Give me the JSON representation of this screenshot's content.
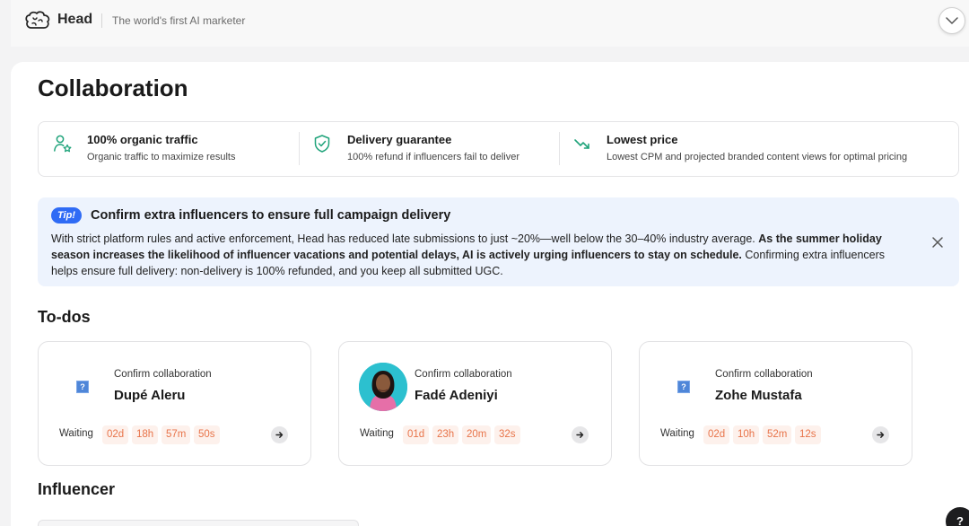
{
  "header": {
    "brand_name": "Head",
    "tagline": "The world's first AI marketer"
  },
  "page": {
    "title": "Collaboration"
  },
  "features": [
    {
      "icon": "user-star-icon",
      "title": "100% organic traffic",
      "desc": "Organic traffic to maximize results"
    },
    {
      "icon": "shield-check-icon",
      "title": "Delivery guarantee",
      "desc": "100% refund if influencers fail to deliver"
    },
    {
      "icon": "trend-down-icon",
      "title": "Lowest price",
      "desc": "Lowest CPM and projected branded content views for optimal pricing"
    }
  ],
  "tip": {
    "badge": "Tip!",
    "title": "Confirm extra influencers to ensure full campaign delivery",
    "body_1": "With strict platform rules and active enforcement, Head has reduced late submissions to just ~20%—well below the 30–40% industry average.",
    "body_bold": "As the summer holiday season increases the likelihood of influencer vacations and potential delays, AI is actively urging influencers to stay on schedule.",
    "body_2": "Confirming extra influencers helps ensure full delivery: non-delivery is 100% refunded, and you keep all submitted UGC."
  },
  "todos": {
    "title": "To-dos",
    "cards": [
      {
        "subtitle": "Confirm collaboration",
        "name": "Dupé Aleru",
        "wait_label": "Waiting",
        "days": "02d",
        "hours": "18h",
        "minutes": "57m",
        "seconds": "50s"
      },
      {
        "subtitle": "Confirm collaboration",
        "name": "Fadé Adeniyi",
        "wait_label": "Waiting",
        "days": "01d",
        "hours": "23h",
        "minutes": "20m",
        "seconds": "32s"
      },
      {
        "subtitle": "Confirm collaboration",
        "name": "Zohe Mustafa",
        "wait_label": "Waiting",
        "days": "02d",
        "hours": "10h",
        "minutes": "52m",
        "seconds": "12s"
      }
    ]
  },
  "influencer": {
    "title": "Influencer"
  },
  "help": {
    "label": "?"
  },
  "colors": {
    "accent": "#2f6bf5",
    "countdown_text": "#e8744a",
    "countdown_bg": "#fdf1ec",
    "feature_icon": "#1fa37a",
    "tip_bg": "#edf3fd"
  }
}
